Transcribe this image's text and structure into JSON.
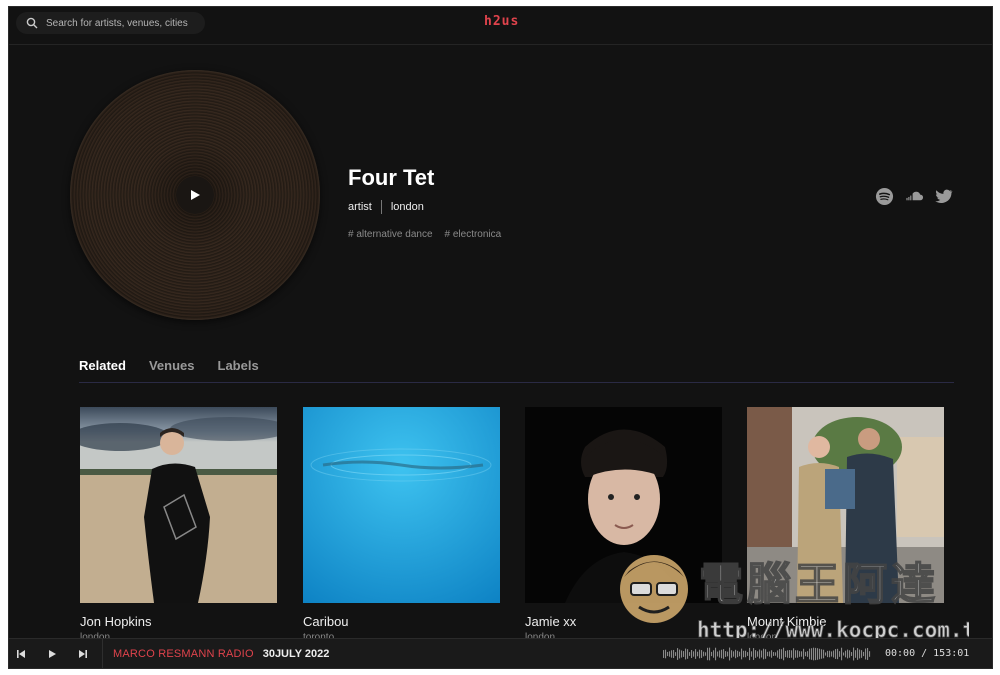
{
  "search": {
    "placeholder": "Search for artists, venues, cities"
  },
  "brand": {
    "logo": "h2us",
    "accent": "#e0434c"
  },
  "artist": {
    "name": "Four Tet",
    "type": "artist",
    "city": "london",
    "tags": [
      "# alternative dance",
      "# electronica"
    ],
    "socials": [
      "spotify-icon",
      "soundcloud-icon",
      "twitter-icon"
    ]
  },
  "tabs": [
    {
      "label": "Related",
      "active": true
    },
    {
      "label": "Venues",
      "active": false
    },
    {
      "label": "Labels",
      "active": false
    }
  ],
  "related": [
    {
      "name": "Jon Hopkins",
      "city": "london"
    },
    {
      "name": "Caribou",
      "city": "toronto"
    },
    {
      "name": "Jamie xx",
      "city": "london"
    },
    {
      "name": "Mount Kimbie",
      "city": "london"
    }
  ],
  "watermark": {
    "title": "電腦王阿達",
    "url": "http://www.kocpc.com.tw"
  },
  "player": {
    "show_title": "MARCO RESMANN RADIO",
    "show_date": "30JULY 2022",
    "time": "00:00 / 153:01"
  }
}
